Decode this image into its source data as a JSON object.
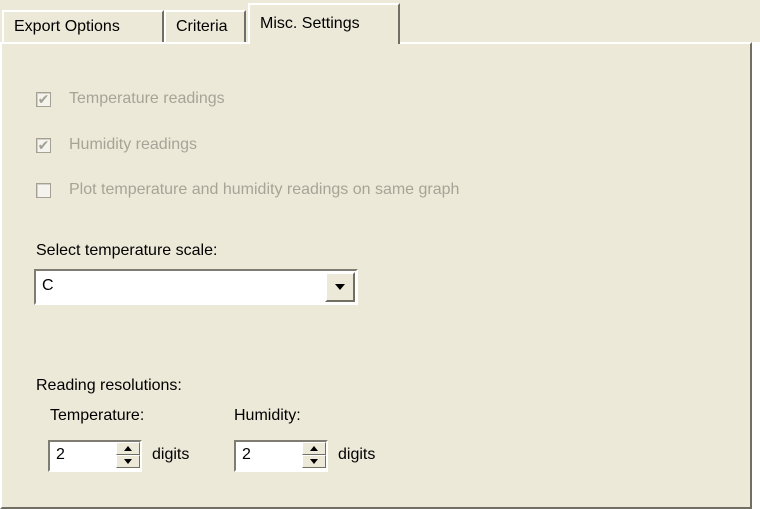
{
  "tabs": [
    {
      "label": "Export Options"
    },
    {
      "label": "Criteria"
    },
    {
      "label": "Misc. Settings"
    }
  ],
  "options": {
    "temperature": {
      "label": "Temperature readings",
      "checked": true
    },
    "humidity": {
      "label": "Humidity readings",
      "checked": true
    },
    "same_graph": {
      "label": "Plot temperature and humidity readings on same graph",
      "checked": false
    }
  },
  "scale": {
    "label": "Select temperature scale:",
    "value": "C"
  },
  "resolutions": {
    "label": "Reading resolutions:",
    "temperature_label": "Temperature:",
    "temperature_value": "2",
    "humidity_label": "Humidity:",
    "humidity_value": "2",
    "unit": "digits"
  }
}
